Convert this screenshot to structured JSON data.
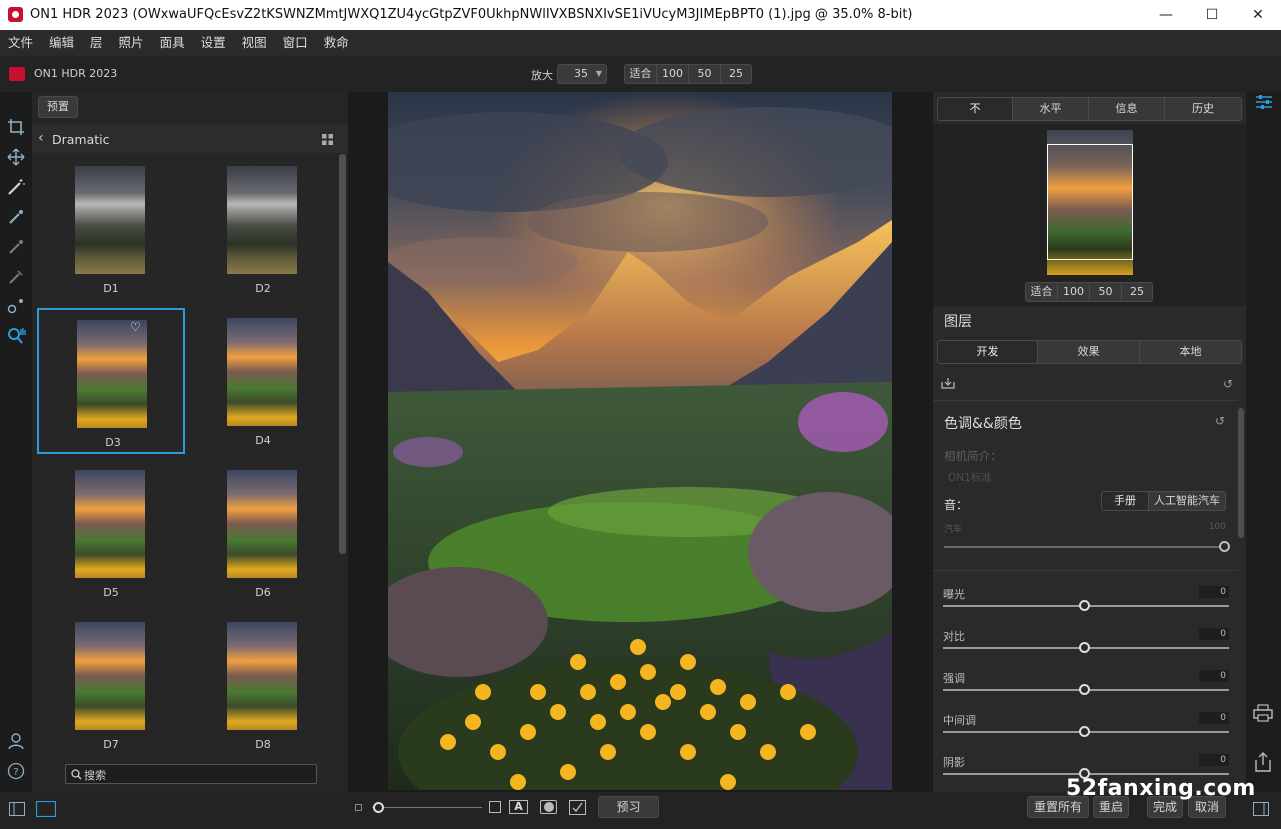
{
  "window": {
    "title": "ON1 HDR 2023 (OWxwaUFQcEsvZ2tKSWNZMmtJWXQ1ZU4ycGtpZVF0UkhpNWlIVXBSNXIvSE1iVUcyM3JIMEpBPT0 (1).jpg @ 35.0% 8-bit)",
    "minimize": "—",
    "maximize": "☐",
    "close": "✕"
  },
  "menu": [
    "文件",
    "编辑",
    "层",
    "照片",
    "面具",
    "设置",
    "视图",
    "窗口",
    "救命"
  ],
  "appbar": {
    "app_name": "ON1 HDR 2023",
    "zoom_label": "放大",
    "zoom_value": "35",
    "zoom_presets": [
      "适合",
      "100",
      "50",
      "25"
    ]
  },
  "browser": {
    "preset_button": "预置",
    "category": "Dramatic",
    "items": [
      {
        "label": "D1",
        "style": "dark"
      },
      {
        "label": "D2",
        "style": "dark"
      },
      {
        "label": "D3",
        "style": "warm",
        "selected": true
      },
      {
        "label": "D4",
        "style": "warm"
      },
      {
        "label": "D5",
        "style": "warm"
      },
      {
        "label": "D6",
        "style": "warm"
      },
      {
        "label": "D7",
        "style": "warm"
      },
      {
        "label": "D8",
        "style": "warm"
      }
    ],
    "search_placeholder": "搜索"
  },
  "right": {
    "tabs": [
      "不",
      "水平",
      "信息",
      "历史"
    ],
    "nav_presets": [
      "适合",
      "100",
      "50",
      "25"
    ],
    "layers_title": "图层",
    "dev_tabs": [
      "开发",
      "效果",
      "本地"
    ],
    "section_title": "色调&&颜色",
    "camera_profile_label": "相机简介：",
    "camera_profile_value": "ON1标准",
    "tone_label": "音：",
    "tone_modes": [
      "手册",
      "人工智能汽车"
    ],
    "auto_label": "汽车",
    "auto_value": "100",
    "sliders": [
      {
        "label": "曝光",
        "value": "0"
      },
      {
        "label": "对比",
        "value": "0"
      },
      {
        "label": "强调",
        "value": "0"
      },
      {
        "label": "中间调",
        "value": "0"
      },
      {
        "label": "阴影",
        "value": "0"
      }
    ]
  },
  "bottom": {
    "preview_button": "预习",
    "reset_all": "重置所有",
    "reset": "重启",
    "done": "完成",
    "cancel": "取消",
    "text_overlay_glyph": "A"
  },
  "watermark": "52fanxing.com",
  "colors": {
    "accent_blue": "#2d9bd7",
    "brand_red": "#c8102e"
  }
}
